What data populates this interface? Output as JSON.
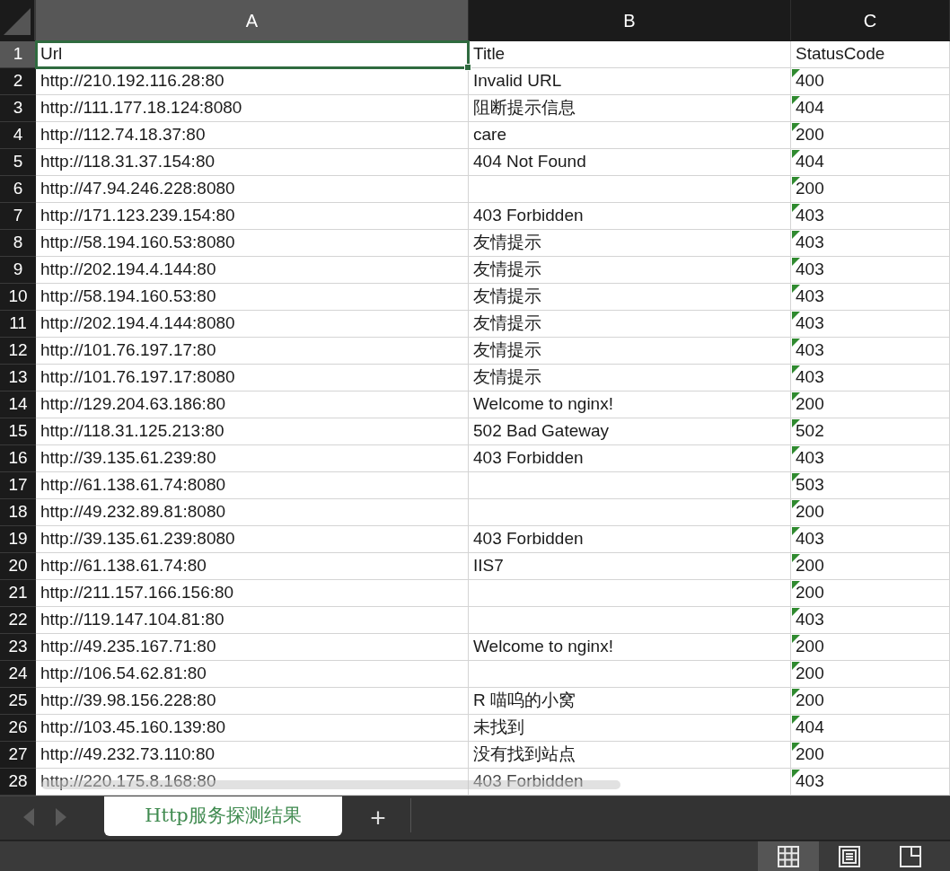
{
  "columns": [
    {
      "label": "A",
      "selected": true
    },
    {
      "label": "B",
      "selected": false
    },
    {
      "label": "C",
      "selected": false
    }
  ],
  "rows": [
    {
      "number": "1",
      "selected": true,
      "text_flag": false,
      "cells": [
        "Url",
        "Title",
        "StatusCode"
      ]
    },
    {
      "number": "2",
      "selected": false,
      "text_flag": true,
      "cells": [
        "http://210.192.116.28:80",
        "Invalid URL",
        "400"
      ]
    },
    {
      "number": "3",
      "selected": false,
      "text_flag": true,
      "cells": [
        "http://111.177.18.124:8080",
        "阻断提示信息",
        "404"
      ]
    },
    {
      "number": "4",
      "selected": false,
      "text_flag": true,
      "cells": [
        "http://112.74.18.37:80",
        "care",
        "200"
      ]
    },
    {
      "number": "5",
      "selected": false,
      "text_flag": true,
      "cells": [
        "http://118.31.37.154:80",
        "404 Not Found",
        "404"
      ]
    },
    {
      "number": "6",
      "selected": false,
      "text_flag": true,
      "cells": [
        "http://47.94.246.228:8080",
        "",
        "200"
      ]
    },
    {
      "number": "7",
      "selected": false,
      "text_flag": true,
      "cells": [
        "http://171.123.239.154:80",
        "403 Forbidden",
        "403"
      ]
    },
    {
      "number": "8",
      "selected": false,
      "text_flag": true,
      "cells": [
        "http://58.194.160.53:8080",
        "友情提示",
        "403"
      ]
    },
    {
      "number": "9",
      "selected": false,
      "text_flag": true,
      "cells": [
        "http://202.194.4.144:80",
        "友情提示",
        "403"
      ]
    },
    {
      "number": "10",
      "selected": false,
      "text_flag": true,
      "cells": [
        "http://58.194.160.53:80",
        "友情提示",
        "403"
      ]
    },
    {
      "number": "11",
      "selected": false,
      "text_flag": true,
      "cells": [
        "http://202.194.4.144:8080",
        "友情提示",
        "403"
      ]
    },
    {
      "number": "12",
      "selected": false,
      "text_flag": true,
      "cells": [
        "http://101.76.197.17:80",
        "友情提示",
        "403"
      ]
    },
    {
      "number": "13",
      "selected": false,
      "text_flag": true,
      "cells": [
        "http://101.76.197.17:8080",
        "友情提示",
        "403"
      ]
    },
    {
      "number": "14",
      "selected": false,
      "text_flag": true,
      "cells": [
        "http://129.204.63.186:80",
        "Welcome to nginx!",
        "200"
      ]
    },
    {
      "number": "15",
      "selected": false,
      "text_flag": true,
      "cells": [
        "http://118.31.125.213:80",
        "502 Bad Gateway",
        "502"
      ]
    },
    {
      "number": "16",
      "selected": false,
      "text_flag": true,
      "cells": [
        "http://39.135.61.239:80",
        "403 Forbidden",
        "403"
      ]
    },
    {
      "number": "17",
      "selected": false,
      "text_flag": true,
      "cells": [
        "http://61.138.61.74:8080",
        "",
        "503"
      ]
    },
    {
      "number": "18",
      "selected": false,
      "text_flag": true,
      "cells": [
        "http://49.232.89.81:8080",
        "",
        "200"
      ]
    },
    {
      "number": "19",
      "selected": false,
      "text_flag": true,
      "cells": [
        "http://39.135.61.239:8080",
        "403 Forbidden",
        "403"
      ]
    },
    {
      "number": "20",
      "selected": false,
      "text_flag": true,
      "cells": [
        "http://61.138.61.74:80",
        "IIS7",
        "200"
      ]
    },
    {
      "number": "21",
      "selected": false,
      "text_flag": true,
      "cells": [
        "http://211.157.166.156:80",
        "",
        "200"
      ]
    },
    {
      "number": "22",
      "selected": false,
      "text_flag": true,
      "cells": [
        "http://119.147.104.81:80",
        "",
        "403"
      ]
    },
    {
      "number": "23",
      "selected": false,
      "text_flag": true,
      "cells": [
        "http://49.235.167.71:80",
        "Welcome to nginx!",
        "200"
      ]
    },
    {
      "number": "24",
      "selected": false,
      "text_flag": true,
      "cells": [
        "http://106.54.62.81:80",
        "",
        "200"
      ]
    },
    {
      "number": "25",
      "selected": false,
      "text_flag": true,
      "cells": [
        "http://39.98.156.228:80",
        "R 喵呜的小窝",
        "200"
      ]
    },
    {
      "number": "26",
      "selected": false,
      "text_flag": true,
      "cells": [
        "http://103.45.160.139:80",
        "未找到",
        "404"
      ]
    },
    {
      "number": "27",
      "selected": false,
      "text_flag": true,
      "cells": [
        "http://49.232.73.110:80",
        "没有找到站点",
        "200"
      ]
    },
    {
      "number": "28",
      "selected": false,
      "text_flag": true,
      "cells": [
        "http://220.175.8.168:80",
        "403 Forbidden",
        "403"
      ]
    }
  ],
  "sheet_tabs": [
    {
      "label": "Http服务探测结果",
      "selected": true
    }
  ],
  "add_sheet": "+",
  "view_modes": [
    {
      "kind": "normal",
      "selected": true
    },
    {
      "kind": "page_layout",
      "selected": false
    },
    {
      "kind": "page_break",
      "selected": false
    }
  ]
}
